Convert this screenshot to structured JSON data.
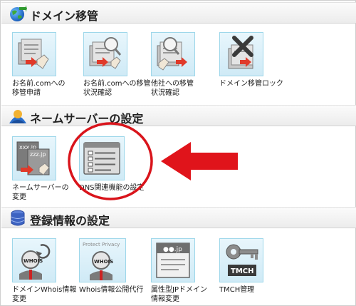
{
  "sections": [
    {
      "title": "ドメイン移管",
      "items": [
        {
          "label": "お名前.comへの\n移管申請",
          "icon": "transfer-in-icon"
        },
        {
          "label": "お名前.comへの移管\n状況確認",
          "icon": "transfer-status-icon"
        },
        {
          "label": "他社への移管\n状況確認",
          "icon": "transfer-out-status-icon"
        },
        {
          "label": "ドメイン移管ロック",
          "icon": "transfer-lock-icon"
        }
      ]
    },
    {
      "title": "ネームサーバーの設定",
      "items": [
        {
          "label": "ネームサーバーの\n変更",
          "icon": "nameserver-change-icon",
          "icon_text": [
            "xxx.jp",
            "zzz.jp"
          ]
        },
        {
          "label": "DNS関連機能の設定",
          "icon": "dns-settings-icon"
        }
      ]
    },
    {
      "title": "登録情報の設定",
      "items": [
        {
          "label": "ドメインWhois情報\n変更",
          "icon": "whois-change-icon",
          "icon_text": "WHOIS"
        },
        {
          "label": "Whois情報公開代行",
          "icon": "whois-privacy-icon",
          "icon_text": "Protect Privacy",
          "icon_text2": "WHOIS"
        },
        {
          "label": "属性型JPドメイン\n情報変更",
          "icon": "jp-domain-icon",
          "icon_text": "●●.jp"
        },
        {
          "label": "TMCH管理",
          "icon": "tmch-icon",
          "icon_text": "TMCH"
        }
      ]
    }
  ],
  "colors": {
    "highlight_circle": "#d9141b",
    "arrow": "#e0141b",
    "tile_border": "#9ed7ea",
    "tile_bg": "#d8eef8"
  }
}
